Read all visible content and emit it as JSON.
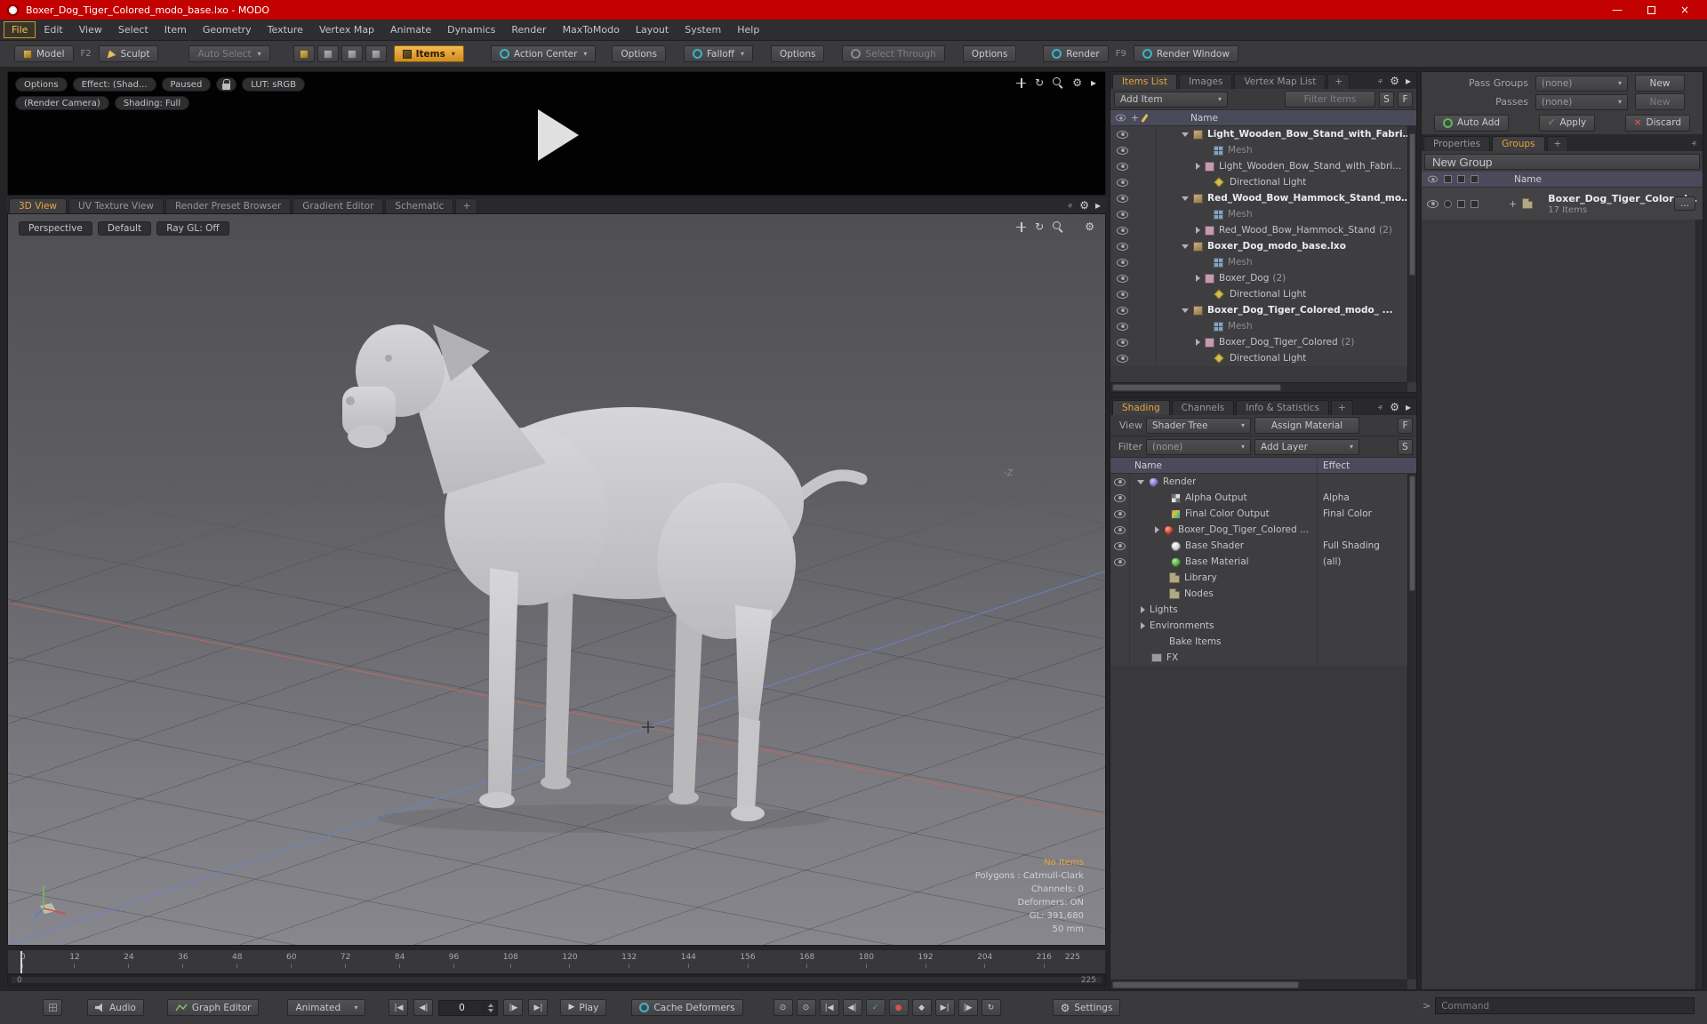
{
  "window": {
    "title": "Boxer_Dog_Tiger_Colored_modo_base.lxo - MODO",
    "minimize": "—",
    "close": "×"
  },
  "menubar": {
    "items": [
      "File",
      "Edit",
      "View",
      "Select",
      "Item",
      "Geometry",
      "Texture",
      "Vertex Map",
      "Animate",
      "Dynamics",
      "Render",
      "MaxToModo",
      "Layout",
      "System",
      "Help"
    ]
  },
  "toolbar": {
    "model": "Model",
    "model_key": "F2",
    "sculpt": "Sculpt",
    "auto_select": "Auto Select",
    "items": "Items",
    "action_center": "Action Center",
    "options_a": "Options",
    "falloff": "Falloff",
    "options_b": "Options",
    "select_through": "Select Through",
    "options_c": "Options",
    "render": "Render",
    "render_key": "F9",
    "render_window": "Render Window"
  },
  "preview": {
    "options": "Options",
    "effect": "Effect: (Shad...",
    "paused": "Paused",
    "lut": "LUT: sRGB",
    "camera": "(Render Camera)",
    "shading": "Shading: Full"
  },
  "viewport": {
    "tabs": [
      "3D View",
      "UV Texture View",
      "Render Preset Browser",
      "Gradient Editor",
      "Schematic",
      "+"
    ],
    "perspective": "Perspective",
    "default": "Default",
    "raygl": "Ray GL: Off",
    "axis_label": "-Z",
    "stats": {
      "no_items": "No Items",
      "polygons": "Polygons : Catmull-Clark",
      "channels": "Channels: 0",
      "deformers": "Deformers: ON",
      "gl": "GL: 391,680",
      "focal": "50 mm"
    }
  },
  "items_panel": {
    "tabs": [
      "Items List",
      "Images",
      "Vertex Map List",
      "+"
    ],
    "add_item": "Add Item",
    "filter_items": "Filter Items",
    "btn_s": "S",
    "btn_f": "F",
    "header_name": "Name",
    "rows": [
      {
        "label": "Light_Wooden_Bow_Stand_with_Fabric_...",
        "count": ""
      },
      {
        "label": "Mesh",
        "count": ""
      },
      {
        "label": "Light_Wooden_Bow_Stand_with_Fabri...",
        "count": ""
      },
      {
        "label": "Directional Light",
        "count": ""
      },
      {
        "label": "Red_Wood_Bow_Hammock_Stand_modo ...",
        "count": ""
      },
      {
        "label": "Mesh",
        "count": ""
      },
      {
        "label": "Red_Wood_Bow_Hammock_Stand",
        "count": "(2)"
      },
      {
        "label": "Boxer_Dog_modo_base.lxo",
        "count": ""
      },
      {
        "label": "Mesh",
        "count": ""
      },
      {
        "label": "Boxer_Dog",
        "count": "(2)"
      },
      {
        "label": "Directional Light",
        "count": ""
      },
      {
        "label": "Boxer_Dog_Tiger_Colored_modo_ ...",
        "count": ""
      },
      {
        "label": "Mesh",
        "count": ""
      },
      {
        "label": "Boxer_Dog_Tiger_Colored",
        "count": "(2)"
      },
      {
        "label": "Directional Light",
        "count": ""
      }
    ]
  },
  "shading_panel": {
    "tabs": [
      "Shading",
      "Channels",
      "Info & Statistics",
      "+"
    ],
    "view_label": "View",
    "view_value": "Shader Tree",
    "assign_material": "Assign Material",
    "btn_f": "F",
    "filter_label": "Filter",
    "filter_value": "(none)",
    "add_layer": "Add Layer",
    "btn_s": "S",
    "header_name": "Name",
    "header_effect": "Effect",
    "rows": [
      {
        "label": "Render",
        "effect": ""
      },
      {
        "label": "Alpha Output",
        "effect": "Alpha"
      },
      {
        "label": "Final Color Output",
        "effect": "Final Color"
      },
      {
        "label": "Boxer_Dog_Tiger_Colored ...",
        "effect": ""
      },
      {
        "label": "Base Shader",
        "effect": "Full Shading"
      },
      {
        "label": "Base Material",
        "effect": "(all)"
      },
      {
        "label": "Library",
        "effect": ""
      },
      {
        "label": "Nodes",
        "effect": ""
      },
      {
        "label": "Lights",
        "effect": ""
      },
      {
        "label": "Environments",
        "effect": ""
      },
      {
        "label": "Bake Items",
        "effect": ""
      },
      {
        "label": "FX",
        "effect": ""
      }
    ]
  },
  "groups_panel": {
    "pass_groups_label": "Pass Groups",
    "pass_groups_value": "(none)",
    "new_a": "New",
    "passes_label": "Passes",
    "passes_value": "(none)",
    "new_b": "New",
    "auto_add": "Auto Add",
    "apply": "Apply",
    "discard": "Discard",
    "tabs": [
      "Properties",
      "Groups",
      "+"
    ],
    "new_group": "New Group",
    "header_name": "Name",
    "row": {
      "label": "Boxer_Dog_Tiger_Colored {",
      "sub": "17 Items",
      "more": "..."
    }
  },
  "timeline": {
    "ticks": [
      "0",
      "12",
      "24",
      "36",
      "48",
      "60",
      "72",
      "84",
      "96",
      "108",
      "120",
      "132",
      "144",
      "156",
      "168",
      "180",
      "192",
      "204",
      "216"
    ],
    "end_label": "225",
    "range_start": "0",
    "range_end": "225"
  },
  "transport": {
    "audio": "Audio",
    "graph_editor": "Graph Editor",
    "anim_mode": "Animated",
    "frame": "0",
    "play": "Play",
    "cache_deformers": "Cache Deformers",
    "settings": "Settings"
  },
  "command": {
    "prompt": ">",
    "placeholder": "Command"
  },
  "colors": {
    "accent_orange": "#e8a33c",
    "accent_teal": "#36b3c3",
    "title_red": "#c30101",
    "green": "#5cb852",
    "red": "#d05448"
  },
  "icons": {
    "dropdown": "▾",
    "gear": "⚙",
    "orbit": "↻",
    "chevron": "▸",
    "plus": "+",
    "play": "▶",
    "go_start": "|◀",
    "prev_key": "◀|",
    "next_key": "|▶",
    "go_end": "▶|",
    "clock": "⊙",
    "check": "✓",
    "dot": "●",
    "diamond": "◆"
  }
}
